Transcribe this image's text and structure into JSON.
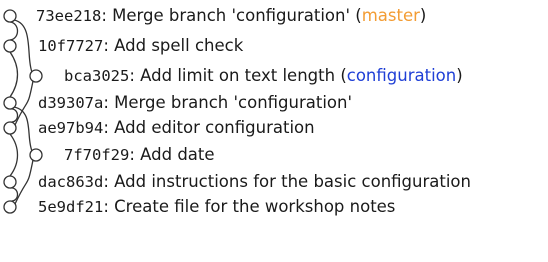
{
  "commits": [
    {
      "hash": "73ee218",
      "message": "Merge branch 'configuration'",
      "ref": "master",
      "ref_color": "#f39c33"
    },
    {
      "hash": "10f7727",
      "message": "Add spell check"
    },
    {
      "hash": "bca3025",
      "message": "Add limit on text length",
      "ref": "configuration",
      "ref_color": "#1f3fd6"
    },
    {
      "hash": "d39307a",
      "message": "Merge branch 'configuration'"
    },
    {
      "hash": "ae97b94",
      "message": "Add editor configuration"
    },
    {
      "hash": "7f70f29",
      "message": "Add date"
    },
    {
      "hash": "dac863d",
      "message": "Add instructions for the basic configuration"
    },
    {
      "hash": "5e9df21",
      "message": "Create file for the workshop notes"
    }
  ],
  "colors": {
    "graph_line": "#333333",
    "node_fill": "#ffffff",
    "text": "#1a1a1a"
  }
}
